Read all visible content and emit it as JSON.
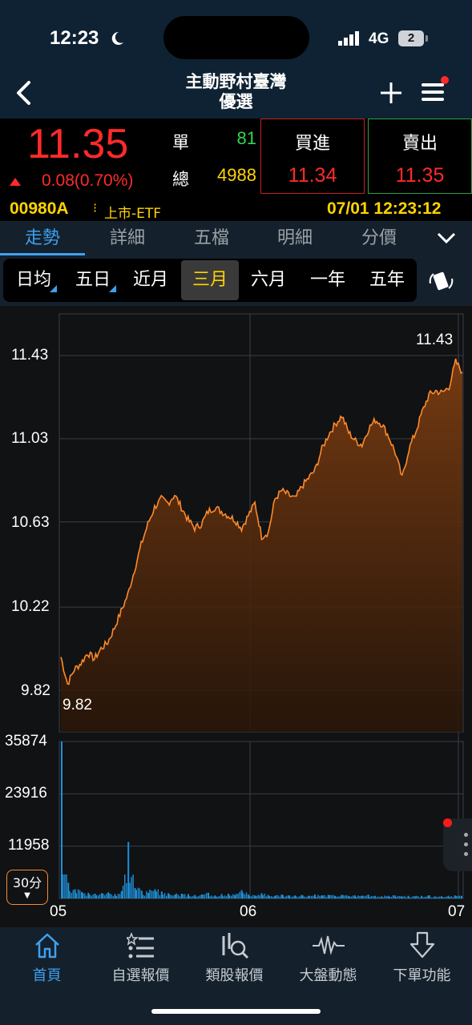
{
  "status": {
    "time": "12:23",
    "network": "4G",
    "battery": "2"
  },
  "nav": {
    "title_line1": "主動野村臺灣",
    "title_line2": "優選"
  },
  "quote": {
    "price": "11.35",
    "change": "0.08(0.70%)",
    "single_label": "單",
    "single_value": "81",
    "total_label": "總",
    "total_value": "4988",
    "bid_label": "買進",
    "bid_value": "11.34",
    "ask_label": "賣出",
    "ask_value": "11.35",
    "symbol": "00980A",
    "market": "上市-ETF",
    "datetime": "07/01 12:23:12"
  },
  "tabs": [
    "走勢",
    "詳細",
    "五檔",
    "明細",
    "分價"
  ],
  "active_tab": "走勢",
  "ranges": [
    "日均",
    "五日",
    "近月",
    "三月",
    "六月",
    "一年",
    "五年"
  ],
  "selected_range": "三月",
  "chart_data": {
    "type": "area",
    "price_yticks": [
      "11.43",
      "11.03",
      "10.63",
      "10.22",
      "9.82"
    ],
    "volume_yticks": [
      "35874",
      "23916",
      "11958"
    ],
    "xticks": [
      "05",
      "06",
      "07"
    ],
    "max_label": "11.43",
    "min_label": "9.82",
    "ylim": [
      9.82,
      11.43
    ],
    "price_series": [
      9.98,
      9.85,
      9.92,
      9.95,
      10.0,
      9.97,
      10.02,
      10.05,
      10.12,
      10.2,
      10.28,
      10.4,
      10.52,
      10.62,
      10.7,
      10.74,
      10.72,
      10.76,
      10.7,
      10.64,
      10.6,
      10.62,
      10.68,
      10.7,
      10.68,
      10.66,
      10.64,
      10.6,
      10.66,
      10.72,
      10.56,
      10.58,
      10.74,
      10.78,
      10.76,
      10.74,
      10.8,
      10.84,
      10.88,
      10.98,
      11.05,
      11.1,
      11.14,
      11.06,
      11.02,
      11.0,
      11.08,
      11.12,
      11.1,
      11.04,
      10.96,
      10.84,
      10.98,
      11.06,
      11.16,
      11.24,
      11.26,
      11.25,
      11.28,
      11.4,
      11.35
    ],
    "volume_series": [
      35874,
      3600,
      2100,
      1500,
      1300,
      1100,
      1200,
      1400,
      1000,
      1700,
      12900,
      2400,
      1800,
      1300,
      2100,
      1600,
      1200,
      900,
      1100,
      1000,
      800,
      900,
      1300,
      700,
      1000,
      1100,
      800,
      1900,
      900,
      700,
      1200,
      800,
      600,
      900,
      700,
      700,
      800,
      600,
      900,
      700,
      800,
      600,
      800,
      600,
      700,
      600,
      900,
      600,
      500,
      600,
      700,
      500,
      600,
      500,
      600,
      700,
      500,
      500,
      600,
      700,
      600
    ],
    "volume_ylim": [
      0,
      35874
    ],
    "floating_label": "30分"
  },
  "bottom_nav": [
    "首頁",
    "自選報價",
    "類股報價",
    "大盤動態",
    "下單功能"
  ],
  "active_nav": "首頁",
  "colors": {
    "up": "#ff2a2a",
    "accent": "#3ea0f0",
    "highlight": "#ffd400",
    "line": "#ff8a2a",
    "volume": "#1e90d8"
  }
}
